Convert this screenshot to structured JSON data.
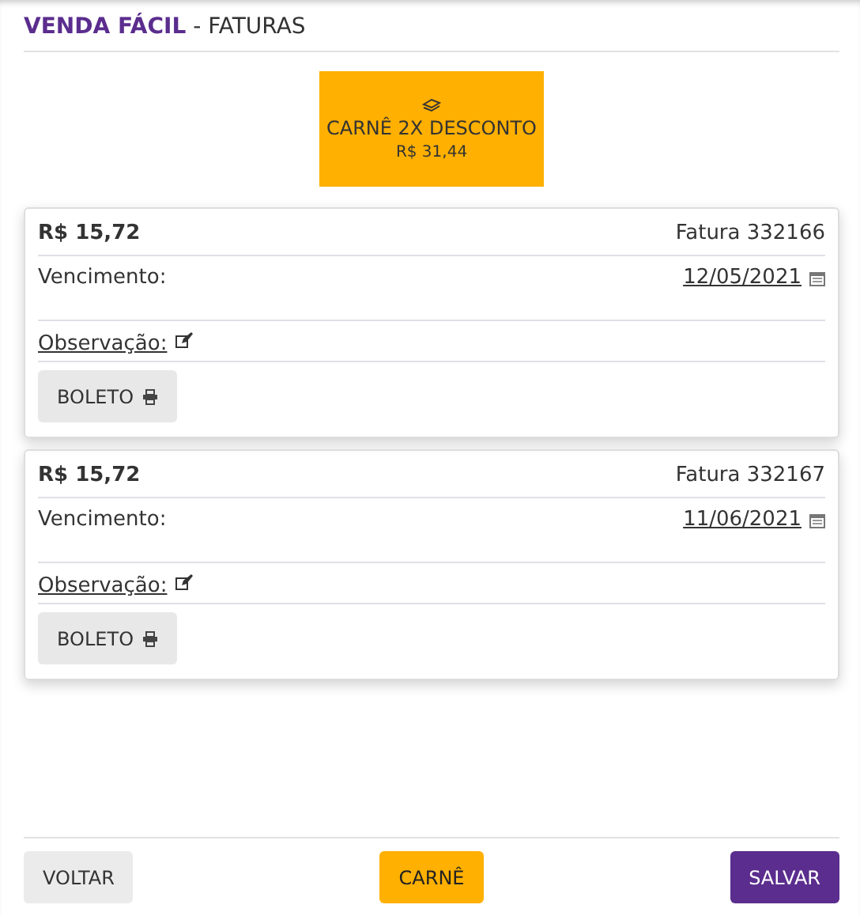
{
  "header": {
    "brand": "VENDA FÁCIL",
    "separator": " - ",
    "title": "FATURAS"
  },
  "carne_offer": {
    "title": "CARNÊ 2X DESCONTO",
    "amount": "R$ 31,44"
  },
  "invoices": [
    {
      "amount": "R$ 15,72",
      "invoice": "Fatura 332166",
      "due_label": "Vencimento:",
      "due_date": "12/05/2021",
      "note_label": "Observação:",
      "button": "BOLETO"
    },
    {
      "amount": "R$ 15,72",
      "invoice": "Fatura 332167",
      "due_label": "Vencimento:",
      "due_date": "11/06/2021",
      "note_label": "Observação:",
      "button": "BOLETO"
    }
  ],
  "footer_buttons": [
    {
      "label": "VOLTAR",
      "kind": "secondary"
    },
    {
      "label": "CARNÊ",
      "kind": "warning"
    },
    {
      "label": "SALVAR",
      "kind": "primary"
    }
  ]
}
